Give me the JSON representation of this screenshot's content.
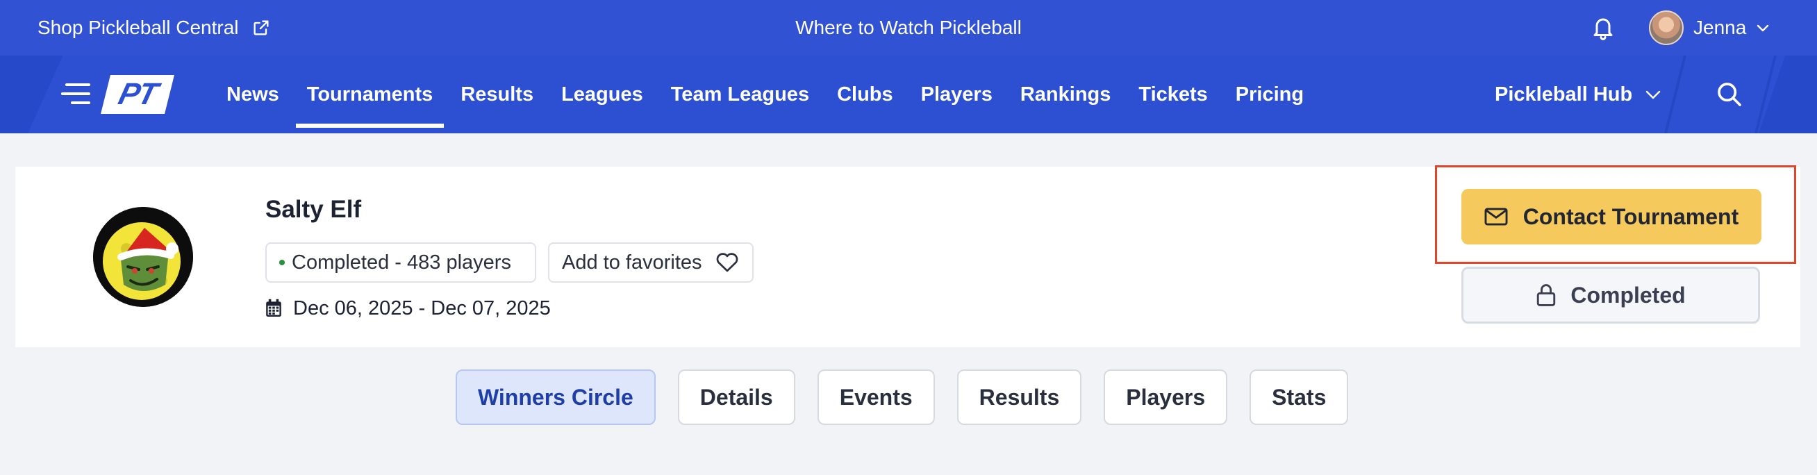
{
  "topbar": {
    "shop_label": "Shop Pickleball Central",
    "watch_label": "Where to Watch Pickleball",
    "user_name": "Jenna"
  },
  "nav": {
    "logo_text": "PT",
    "items": [
      {
        "label": "News"
      },
      {
        "label": "Tournaments",
        "active": true
      },
      {
        "label": "Results"
      },
      {
        "label": "Leagues"
      },
      {
        "label": "Team Leagues"
      },
      {
        "label": "Clubs"
      },
      {
        "label": "Players"
      },
      {
        "label": "Rankings"
      },
      {
        "label": "Tickets"
      },
      {
        "label": "Pricing"
      }
    ],
    "hub_label": "Pickleball Hub"
  },
  "tournament": {
    "name": "Salty Elf",
    "status": "Completed - 483 players",
    "favorites_label": "Add to favorites",
    "dates": "Dec 06, 2025 - Dec 07, 2025",
    "contact_label": "Contact Tournament",
    "completed_label": "Completed"
  },
  "tabs": [
    {
      "label": "Winners Circle",
      "active": true
    },
    {
      "label": "Details"
    },
    {
      "label": "Events"
    },
    {
      "label": "Results"
    },
    {
      "label": "Players"
    },
    {
      "label": "Stats"
    }
  ],
  "colors": {
    "topbar": "#3052d3",
    "navbar": "#2d50d2",
    "contact_button": "#f5c95c",
    "highlight_border": "#e0452b",
    "active_tab": "#dde6fb"
  }
}
